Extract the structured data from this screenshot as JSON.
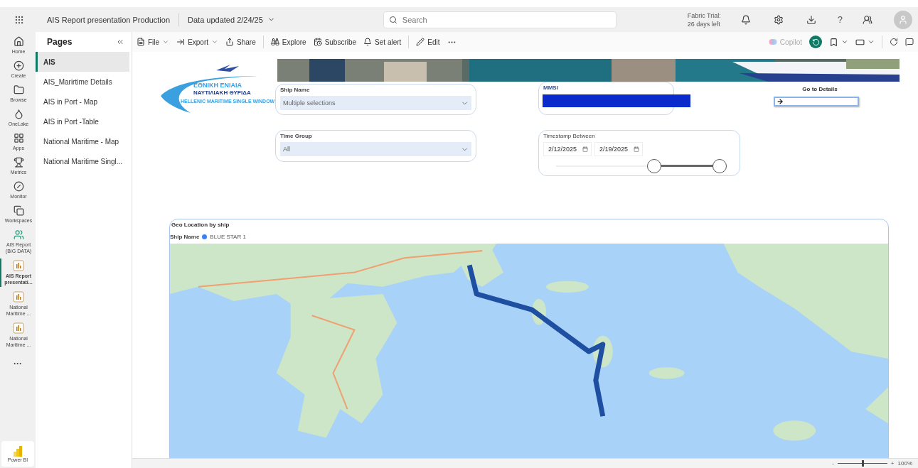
{
  "header": {
    "title": "AIS Report presentation Production",
    "data_updated": "Data updated 2/24/25",
    "search_placeholder": "Search",
    "trial": [
      "Fabric Trial:",
      "26 days left"
    ],
    "help": "?"
  },
  "nav": [
    {
      "label": "Home",
      "selected": false
    },
    {
      "label": "Create",
      "selected": false
    },
    {
      "label": "Browse",
      "selected": false
    },
    {
      "label": "OneLake",
      "selected": false
    },
    {
      "label": "Apps",
      "selected": false
    },
    {
      "label": "Metrics",
      "selected": false
    },
    {
      "label": "Monitor",
      "selected": false
    },
    {
      "label": "Workspaces",
      "selected": false
    },
    {
      "label": "AIS Report (BIG DATA)",
      "selected": false
    },
    {
      "label": "AIS Report presentati...",
      "selected": true
    },
    {
      "label": "National Maritime ...",
      "selected": false
    },
    {
      "label": "National Maritime ...",
      "selected": false
    }
  ],
  "nav_more": "···",
  "brand": "Power BI",
  "pages_pane": {
    "title": "Pages",
    "items": [
      {
        "label": "AIS",
        "selected": true
      },
      {
        "label": "AIS_Marirtime Details",
        "selected": false
      },
      {
        "label": "AIS in Port - Map",
        "selected": false
      },
      {
        "label": "AIS in Port -Table",
        "selected": false
      },
      {
        "label": "National Maritime - Map",
        "selected": false
      },
      {
        "label": "National Maritime Singl...",
        "selected": false
      }
    ]
  },
  "toolbar": {
    "items": [
      {
        "label": "File",
        "dropdown": true
      },
      {
        "label": "Export",
        "dropdown": true
      },
      {
        "label": "Share",
        "dropdown": false
      },
      {
        "label": "Explore",
        "dropdown": false
      },
      {
        "label": "Subscribe",
        "dropdown": false
      },
      {
        "label": "Set alert",
        "dropdown": false
      },
      {
        "label": "Edit",
        "dropdown": false
      }
    ],
    "copilot": {
      "label": "Copilot",
      "disabled": true
    }
  },
  "report": {
    "logo": {
      "line_1": "ΕΘΝΙΚΗ ΕΝΙΑΙΑ",
      "line_2": "ΝΑΥΤΙΛΙΑΚΗ ΘΥΡΙΔΑ",
      "line_3": "HELLENIC MARITIME SINGLE WINDOW"
    },
    "ship_name": {
      "label": "Ship Name",
      "value": "Multiple selections"
    },
    "mmsi": {
      "label": "MMSI"
    },
    "go_to_details": {
      "label": "Go to Details"
    },
    "time_group": {
      "label": "Time Group",
      "value": "All"
    },
    "timestamp": {
      "label": "Timestamp Between",
      "start": "2/12/2025",
      "end": "2/19/2025",
      "thumbs": [
        {
          "level": 0.6
        },
        {
          "level": 1
        }
      ]
    },
    "map": {
      "title": "Geo Location by ship",
      "legend_title": "Ship Name",
      "legend": [
        {
          "label": "BLUE STAR 1",
          "color": "#3b82f6"
        }
      ]
    }
  },
  "status_bar": {
    "zoom_out": "-",
    "zoom_in": "+",
    "zoom": "100%",
    "level": 0.5
  }
}
